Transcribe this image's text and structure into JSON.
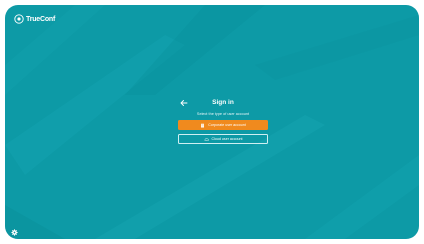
{
  "brand": {
    "name": "TrueConf"
  },
  "signin": {
    "title": "Sign in",
    "subtitle": "Select the type of user account",
    "corporate_button": "Corporate user account",
    "cloud_button": "Cloud user account"
  },
  "icons": {
    "back": "arrow-left-icon",
    "corporate": "building-icon",
    "cloud": "cloud-icon",
    "settings": "gear-icon"
  },
  "colors": {
    "background": "#0d9aa6",
    "primary_button": "#f08a1e",
    "text": "#ffffff"
  }
}
